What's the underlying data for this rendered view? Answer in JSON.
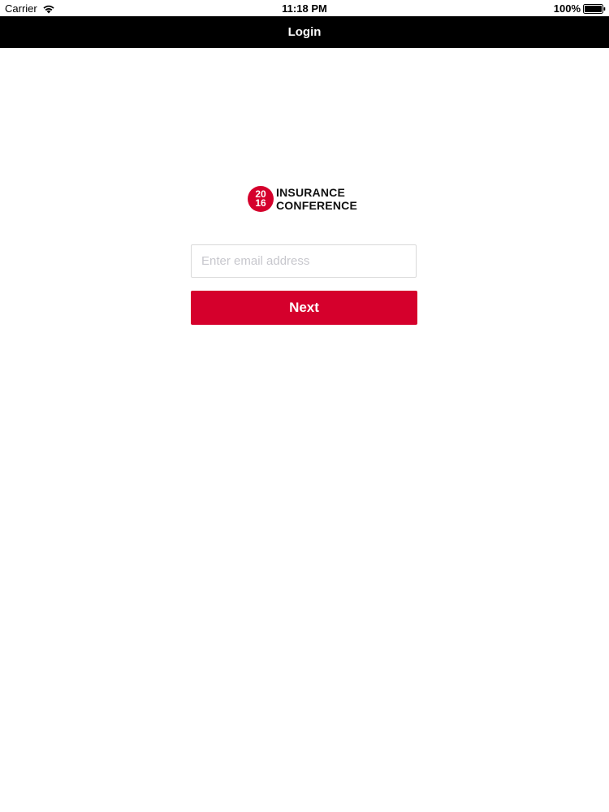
{
  "status_bar": {
    "carrier": "Carrier",
    "time": "11:18 PM",
    "battery": "100%",
    "icons": [
      "wifi-icon",
      "battery-icon"
    ]
  },
  "nav_bar": {
    "title": "Login"
  },
  "logo": {
    "badge_top": "20",
    "badge_bottom": "16",
    "line1": "INSURANCE",
    "line2": "CONFERENCE"
  },
  "form": {
    "email": {
      "value": "",
      "placeholder": "Enter email address"
    },
    "next_label": "Next"
  },
  "colors": {
    "brand_red": "#d5002c",
    "nav_bg": "#000000",
    "input_border": "#d9d9d9"
  }
}
